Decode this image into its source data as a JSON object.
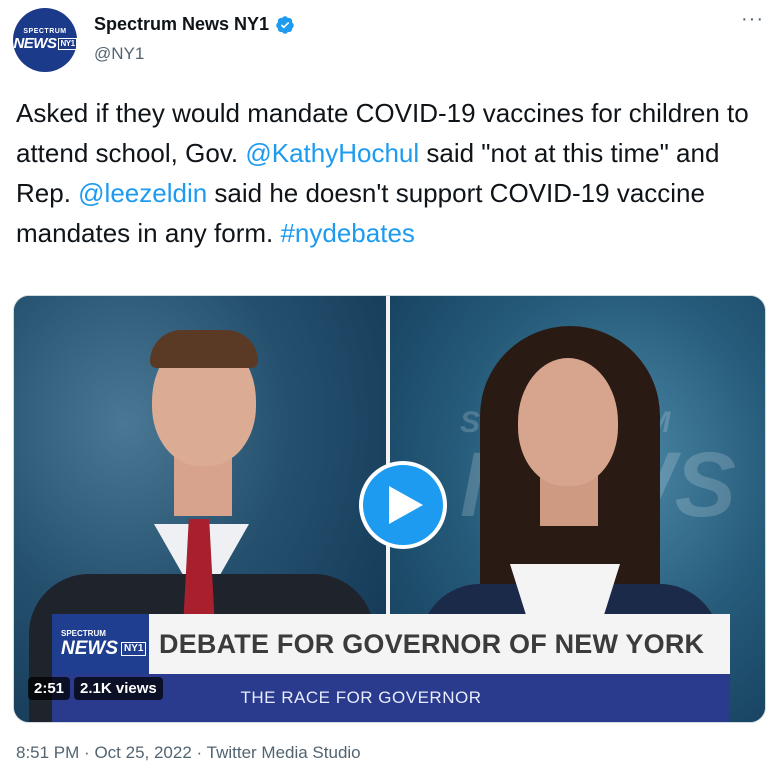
{
  "author": {
    "display_name": "Spectrum News NY1",
    "handle": "@NY1",
    "avatar_small_text": "SPECTRUM",
    "avatar_big_text": "NEWS",
    "avatar_badge": "NY1",
    "verified_icon": "verified-badge-icon",
    "more_icon": "more-dots-icon"
  },
  "tweet": {
    "text_1": "Asked if they would mandate COVID-19 vaccines for children to attend school, Gov. ",
    "mention_1": "@KathyHochul",
    "text_2": " said \"not at this time\" and Rep. ",
    "mention_2": "@leezeldin",
    "text_3": " said he doesn't support COVID-19 vaccine mandates in any form. ",
    "hashtag": "#nydebates"
  },
  "media": {
    "bg_letters_top": "SPECTRUM",
    "bg_letters_big": "NEWS",
    "lower_third_small": "SPECTRUM",
    "lower_third_logo": "NEWS",
    "lower_third_badge": "NY1",
    "lower_third_title": "DEBATE FOR GOVERNOR OF NEW YORK",
    "lower_third_subtitle": "THE RACE FOR GOVERNOR",
    "duration": "2:51",
    "views": "2.1K views",
    "play_icon": "play-icon"
  },
  "meta": {
    "time": "8:51 PM",
    "separator": "·",
    "date": "Oct 25, 2022",
    "source": "Twitter Media Studio"
  },
  "colors": {
    "link": "#1d9bf0",
    "text": "#0f1419",
    "secondary": "#536471",
    "brand_blue": "#1f3e8f"
  }
}
